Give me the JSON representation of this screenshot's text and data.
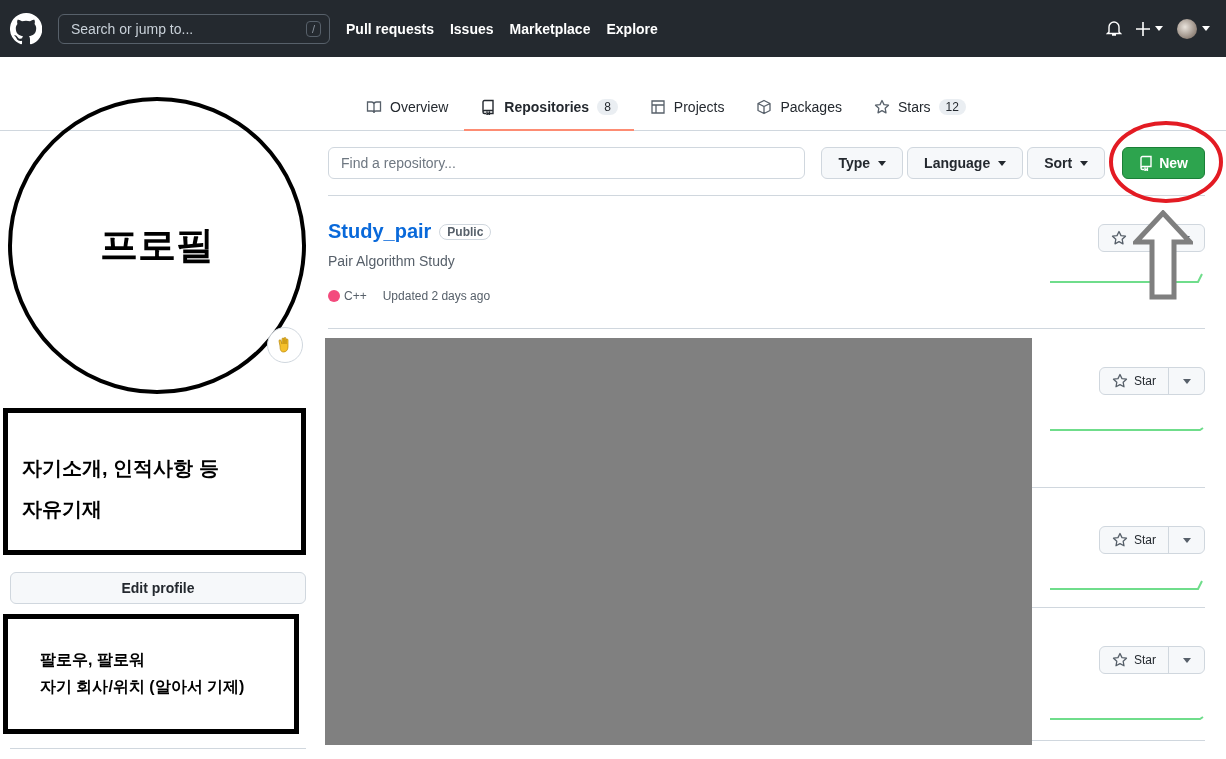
{
  "header": {
    "search_placeholder": "Search or jump to...",
    "search_key": "/",
    "nav": [
      "Pull requests",
      "Issues",
      "Marketplace",
      "Explore"
    ]
  },
  "tabs": [
    {
      "kind": "book",
      "label": "Overview",
      "selected": false
    },
    {
      "kind": "repo",
      "label": "Repositories",
      "count": "8",
      "selected": true
    },
    {
      "kind": "table",
      "label": "Projects",
      "selected": false
    },
    {
      "kind": "package",
      "label": "Packages",
      "selected": false
    },
    {
      "kind": "star",
      "label": "Stars",
      "count": "12",
      "selected": false
    }
  ],
  "filter": {
    "placeholder": "Find a repository...",
    "buttons": [
      "Type",
      "Language",
      "Sort"
    ],
    "new_label": "New"
  },
  "repositories": [
    {
      "kind": "full",
      "name": "Study_pair",
      "visibility": "Public",
      "description": "Pair Algorithm Study",
      "language": "C++",
      "color": "#f34b7d",
      "updated": "Updated 2 days ago"
    },
    {
      "kind": "covered",
      "star_label": "Star"
    },
    {
      "kind": "covered",
      "star_label": "Star"
    },
    {
      "kind": "covered",
      "star_label": "Star"
    }
  ],
  "profile": {
    "annotation": "프로필",
    "bio_lines": [
      "자기소개, 인적사항 등",
      "자유기재"
    ],
    "edit_label": "Edit profile",
    "info_lines": [
      "팔로우, 팔로워",
      "자기 회사/위치 (알아서 기제)"
    ]
  }
}
